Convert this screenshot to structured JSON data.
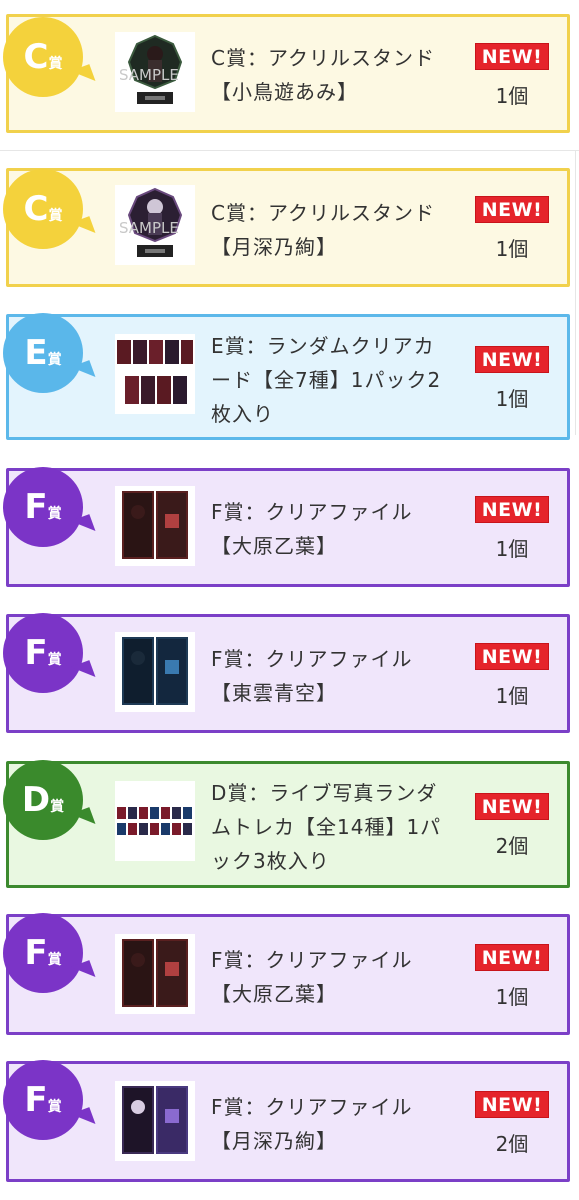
{
  "colors": {
    "c_prize": {
      "border": "#f1d14c",
      "bg": "#fdf9e3",
      "badge": "#f4d23c"
    },
    "e_prize": {
      "border": "#5cb8ea",
      "bg": "#e3f4fd",
      "badge": "#5ab7ea"
    },
    "f_prize": {
      "border": "#7b3fc7",
      "bg": "#f0e6fb",
      "badge": "#7b34c7"
    },
    "d_prize": {
      "border": "#3c8a2e",
      "bg": "#e9f8e1",
      "badge": "#3a8a2c"
    },
    "new_badge": "#e5242b"
  },
  "items": [
    {
      "grade": "C",
      "sho": "賞",
      "title_line1": "C賞：アクリルスタンド",
      "title_line2": "【小鳥遊あみ】",
      "title_line3": "",
      "new": "NEW!",
      "quantity": "1個",
      "thumb_icon": "acrylic-stand-icon",
      "thumb_sample": "SAMPLE"
    },
    {
      "grade": "C",
      "sho": "賞",
      "title_line1": "C賞：アクリルスタンド",
      "title_line2": "【月深乃絢】",
      "title_line3": "",
      "new": "NEW!",
      "quantity": "1個",
      "thumb_icon": "acrylic-stand-icon",
      "thumb_sample": "SAMPLE"
    },
    {
      "grade": "E",
      "sho": "賞",
      "title_line1": "E賞：ランダムクリアカ",
      "title_line2": "ード【全7種】1パック2",
      "title_line3": "枚入り",
      "new": "NEW!",
      "quantity": "1個",
      "thumb_icon": "clear-cards-icon",
      "thumb_sample": ""
    },
    {
      "grade": "F",
      "sho": "賞",
      "title_line1": "F賞：クリアファイル",
      "title_line2": "【大原乙葉】",
      "title_line3": "",
      "new": "NEW!",
      "quantity": "1個",
      "thumb_icon": "clear-file-icon",
      "thumb_sample": ""
    },
    {
      "grade": "F",
      "sho": "賞",
      "title_line1": "F賞：クリアファイル",
      "title_line2": "【東雲青空】",
      "title_line3": "",
      "new": "NEW!",
      "quantity": "1個",
      "thumb_icon": "clear-file-icon",
      "thumb_sample": ""
    },
    {
      "grade": "D",
      "sho": "賞",
      "title_line1": "D賞：ライブ写真ランダ",
      "title_line2": "ムトレカ【全14種】1パ",
      "title_line3": "ック3枚入り",
      "new": "NEW!",
      "quantity": "2個",
      "thumb_icon": "trading-cards-icon",
      "thumb_sample": ""
    },
    {
      "grade": "F",
      "sho": "賞",
      "title_line1": "F賞：クリアファイル",
      "title_line2": "【大原乙葉】",
      "title_line3": "",
      "new": "NEW!",
      "quantity": "1個",
      "thumb_icon": "clear-file-icon",
      "thumb_sample": ""
    },
    {
      "grade": "F",
      "sho": "賞",
      "title_line1": "F賞：クリアファイル",
      "title_line2": "【月深乃絢】",
      "title_line3": "",
      "new": "NEW!",
      "quantity": "2個",
      "thumb_icon": "clear-file-icon",
      "thumb_sample": ""
    }
  ]
}
